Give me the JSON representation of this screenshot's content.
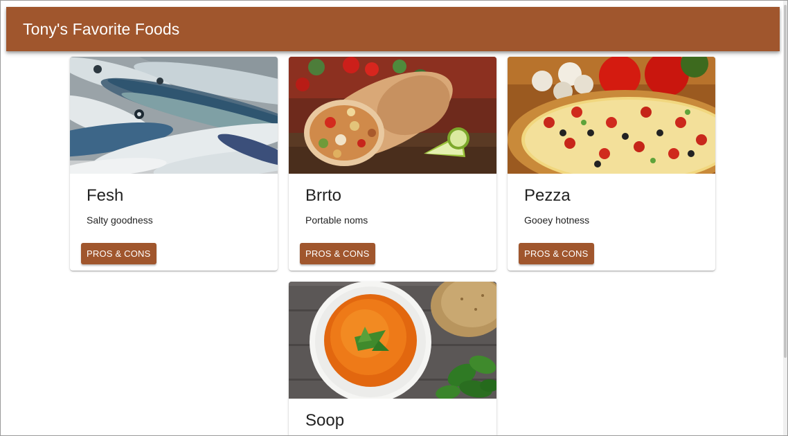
{
  "app": {
    "title": "Tony's Favorite Foods"
  },
  "theme": {
    "primary": "#a0562d",
    "on_primary": "#ffffff"
  },
  "cards": [
    {
      "title": "Fesh",
      "description": "Salty goodness",
      "button_label": "PROS & CONS",
      "image": "fish-photo"
    },
    {
      "title": "Brrto",
      "description": "Portable noms",
      "button_label": "PROS & CONS",
      "image": "burrito-photo"
    },
    {
      "title": "Pezza",
      "description": "Gooey hotness",
      "button_label": "PROS & CONS",
      "image": "pizza-photo"
    },
    {
      "title": "Soop",
      "description": "",
      "button_label": "",
      "image": "soup-photo"
    }
  ]
}
